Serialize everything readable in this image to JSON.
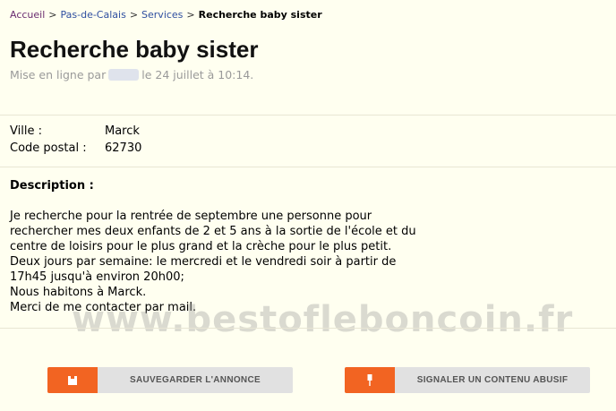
{
  "breadcrumb": {
    "items": [
      "Accueil",
      "Pas-de-Calais",
      "Services"
    ],
    "separator": ">",
    "current": "Recherche baby sister"
  },
  "ad": {
    "title": "Recherche baby sister",
    "posted_prefix": "Mise en ligne par",
    "posted_suffix": "le 24 juillet à 10:14."
  },
  "details": {
    "ville_label": "Ville :",
    "ville_value": "Marck",
    "cp_label": "Code postal :",
    "cp_value": "62730"
  },
  "description": {
    "heading": "Description :",
    "lines": [
      "Je recherche pour la rentrée de septembre une personne pour",
      "rechercher mes deux enfants de 2 et 5 ans à la sortie de l'école et du",
      "centre de loisirs pour le plus grand et la crèche pour le plus petit.",
      "Deux jours par semaine: le mercredi et le vendredi soir à partir de",
      "17h45 jusqu'à environ 20h00;",
      "Nous habitons à Marck.",
      "Merci de me contacter par mail."
    ]
  },
  "watermark": "www.bestofleboncoin.fr",
  "actions": {
    "save_label": "SAUVEGARDER L'ANNONCE",
    "report_label": "SIGNALER UN CONTENU ABUSIF"
  },
  "colors": {
    "background": "#fffff0",
    "accent": "#f26422",
    "button_bg": "#e1e1e1",
    "link": "#2f4fa0"
  }
}
